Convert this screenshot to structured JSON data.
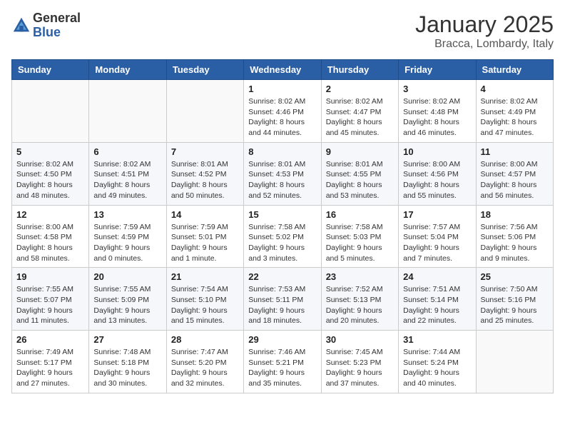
{
  "header": {
    "logo_general": "General",
    "logo_blue": "Blue",
    "month": "January 2025",
    "location": "Bracca, Lombardy, Italy"
  },
  "weekdays": [
    "Sunday",
    "Monday",
    "Tuesday",
    "Wednesday",
    "Thursday",
    "Friday",
    "Saturday"
  ],
  "weeks": [
    [
      {
        "day": "",
        "info": ""
      },
      {
        "day": "",
        "info": ""
      },
      {
        "day": "",
        "info": ""
      },
      {
        "day": "1",
        "info": "Sunrise: 8:02 AM\nSunset: 4:46 PM\nDaylight: 8 hours\nand 44 minutes."
      },
      {
        "day": "2",
        "info": "Sunrise: 8:02 AM\nSunset: 4:47 PM\nDaylight: 8 hours\nand 45 minutes."
      },
      {
        "day": "3",
        "info": "Sunrise: 8:02 AM\nSunset: 4:48 PM\nDaylight: 8 hours\nand 46 minutes."
      },
      {
        "day": "4",
        "info": "Sunrise: 8:02 AM\nSunset: 4:49 PM\nDaylight: 8 hours\nand 47 minutes."
      }
    ],
    [
      {
        "day": "5",
        "info": "Sunrise: 8:02 AM\nSunset: 4:50 PM\nDaylight: 8 hours\nand 48 minutes."
      },
      {
        "day": "6",
        "info": "Sunrise: 8:02 AM\nSunset: 4:51 PM\nDaylight: 8 hours\nand 49 minutes."
      },
      {
        "day": "7",
        "info": "Sunrise: 8:01 AM\nSunset: 4:52 PM\nDaylight: 8 hours\nand 50 minutes."
      },
      {
        "day": "8",
        "info": "Sunrise: 8:01 AM\nSunset: 4:53 PM\nDaylight: 8 hours\nand 52 minutes."
      },
      {
        "day": "9",
        "info": "Sunrise: 8:01 AM\nSunset: 4:55 PM\nDaylight: 8 hours\nand 53 minutes."
      },
      {
        "day": "10",
        "info": "Sunrise: 8:00 AM\nSunset: 4:56 PM\nDaylight: 8 hours\nand 55 minutes."
      },
      {
        "day": "11",
        "info": "Sunrise: 8:00 AM\nSunset: 4:57 PM\nDaylight: 8 hours\nand 56 minutes."
      }
    ],
    [
      {
        "day": "12",
        "info": "Sunrise: 8:00 AM\nSunset: 4:58 PM\nDaylight: 8 hours\nand 58 minutes."
      },
      {
        "day": "13",
        "info": "Sunrise: 7:59 AM\nSunset: 4:59 PM\nDaylight: 9 hours\nand 0 minutes."
      },
      {
        "day": "14",
        "info": "Sunrise: 7:59 AM\nSunset: 5:01 PM\nDaylight: 9 hours\nand 1 minute."
      },
      {
        "day": "15",
        "info": "Sunrise: 7:58 AM\nSunset: 5:02 PM\nDaylight: 9 hours\nand 3 minutes."
      },
      {
        "day": "16",
        "info": "Sunrise: 7:58 AM\nSunset: 5:03 PM\nDaylight: 9 hours\nand 5 minutes."
      },
      {
        "day": "17",
        "info": "Sunrise: 7:57 AM\nSunset: 5:04 PM\nDaylight: 9 hours\nand 7 minutes."
      },
      {
        "day": "18",
        "info": "Sunrise: 7:56 AM\nSunset: 5:06 PM\nDaylight: 9 hours\nand 9 minutes."
      }
    ],
    [
      {
        "day": "19",
        "info": "Sunrise: 7:55 AM\nSunset: 5:07 PM\nDaylight: 9 hours\nand 11 minutes."
      },
      {
        "day": "20",
        "info": "Sunrise: 7:55 AM\nSunset: 5:09 PM\nDaylight: 9 hours\nand 13 minutes."
      },
      {
        "day": "21",
        "info": "Sunrise: 7:54 AM\nSunset: 5:10 PM\nDaylight: 9 hours\nand 15 minutes."
      },
      {
        "day": "22",
        "info": "Sunrise: 7:53 AM\nSunset: 5:11 PM\nDaylight: 9 hours\nand 18 minutes."
      },
      {
        "day": "23",
        "info": "Sunrise: 7:52 AM\nSunset: 5:13 PM\nDaylight: 9 hours\nand 20 minutes."
      },
      {
        "day": "24",
        "info": "Sunrise: 7:51 AM\nSunset: 5:14 PM\nDaylight: 9 hours\nand 22 minutes."
      },
      {
        "day": "25",
        "info": "Sunrise: 7:50 AM\nSunset: 5:16 PM\nDaylight: 9 hours\nand 25 minutes."
      }
    ],
    [
      {
        "day": "26",
        "info": "Sunrise: 7:49 AM\nSunset: 5:17 PM\nDaylight: 9 hours\nand 27 minutes."
      },
      {
        "day": "27",
        "info": "Sunrise: 7:48 AM\nSunset: 5:18 PM\nDaylight: 9 hours\nand 30 minutes."
      },
      {
        "day": "28",
        "info": "Sunrise: 7:47 AM\nSunset: 5:20 PM\nDaylight: 9 hours\nand 32 minutes."
      },
      {
        "day": "29",
        "info": "Sunrise: 7:46 AM\nSunset: 5:21 PM\nDaylight: 9 hours\nand 35 minutes."
      },
      {
        "day": "30",
        "info": "Sunrise: 7:45 AM\nSunset: 5:23 PM\nDaylight: 9 hours\nand 37 minutes."
      },
      {
        "day": "31",
        "info": "Sunrise: 7:44 AM\nSunset: 5:24 PM\nDaylight: 9 hours\nand 40 minutes."
      },
      {
        "day": "",
        "info": ""
      }
    ]
  ]
}
